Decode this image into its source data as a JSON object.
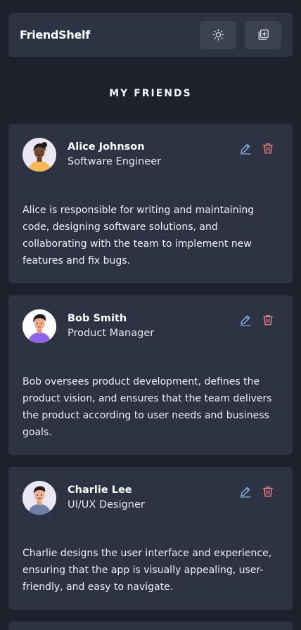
{
  "app": {
    "brand": "FriendShelf",
    "section_title": "MY FRIENDS"
  },
  "header": {
    "theme_toggle_icon": "sun-icon",
    "add_friend_icon": "add-square-icon"
  },
  "friends": [
    {
      "name": "Alice Johnson",
      "role": "Software Engineer",
      "description": "Alice is responsible for writing and maintaining code, designing software solutions, and collaborating with the team to implement new features and fix bugs.",
      "avatar_icon": "avatar-alice-icon"
    },
    {
      "name": "Bob Smith",
      "role": "Product Manager",
      "description": "Bob oversees product development, defines the product vision, and ensures that the team delivers the product according to user needs and business goals.",
      "avatar_icon": "avatar-bob-icon"
    },
    {
      "name": "Charlie Lee",
      "role": "UI/UX Designer",
      "description": "Charlie designs the user interface and experience, ensuring that the app is visually appealing, user-friendly, and easy to navigate.",
      "avatar_icon": "avatar-charlie-icon"
    }
  ],
  "colors": {
    "background": "#1c212c",
    "card": "#2d3342",
    "button": "#3b4251",
    "edit_icon": "#7fb3ea",
    "delete_icon": "#ec8a8a"
  }
}
